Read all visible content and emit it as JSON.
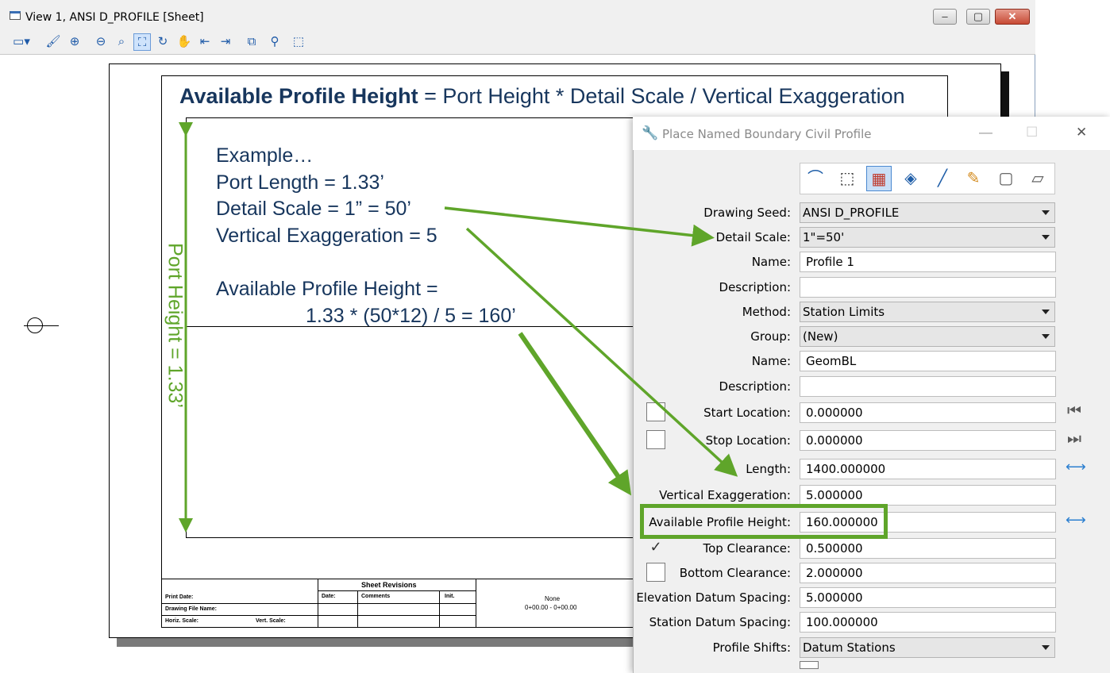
{
  "view": {
    "title": "View 1, ANSI D_PROFILE [Sheet]",
    "minimize": "–",
    "maximize": "▢",
    "close": "✕"
  },
  "sheet": {
    "formula_bold": "Available Profile Height",
    "formula_rest": " = Port Height * Detail Scale / Vertical Exaggeration",
    "example_title": "Example…",
    "port_length": "Port Length = 1.33’",
    "detail_scale": "Detail Scale = 1” = 50’",
    "vertical_exaggeration": "Vertical Exaggeration = 5",
    "aph_label": "Available Profile Height =",
    "aph_calc": "1.33 * (50*12) / 5 = 160’",
    "port_height": "Port Height = 1.33’",
    "titleblock": {
      "sheet_revisions": "Sheet Revisions",
      "print_date": "Print Date:",
      "drawing_file_name": "Drawing File Name:",
      "horiz_scale": "Horiz. Scale:",
      "vert_scale": "Vert. Scale:",
      "date": "Date:",
      "comments": "Comments",
      "init": "Init.",
      "none": "None",
      "station_range": "0+00.00 - 0+00.00"
    }
  },
  "dialog": {
    "title": "Place Named Boundary Civil Profile",
    "minimize": "—",
    "maximize": "☐",
    "close": "✕",
    "fields": {
      "drawing_seed": {
        "label": "Drawing Seed:",
        "value": "ANSI D_PROFILE"
      },
      "detail_scale": {
        "label": "Detail Scale:",
        "value": "1\"=50'"
      },
      "name1": {
        "label": "Name:",
        "value": "Profile 1"
      },
      "description1": {
        "label": "Description:",
        "value": ""
      },
      "method": {
        "label": "Method:",
        "value": "Station Limits"
      },
      "group": {
        "label": "Group:",
        "value": "(New)"
      },
      "name2": {
        "label": "Name:",
        "value": "GeomBL"
      },
      "description2": {
        "label": "Description:",
        "value": ""
      },
      "start_location": {
        "label": "Start Location:",
        "value": "0.000000"
      },
      "stop_location": {
        "label": "Stop Location:",
        "value": "0.000000"
      },
      "length": {
        "label": "Length:",
        "value": "1400.000000"
      },
      "vertical_exaggeration": {
        "label": "Vertical Exaggeration:",
        "value": "5.000000"
      },
      "available_profile_height": {
        "label": "Available Profile Height:",
        "value": "160.000000"
      },
      "top_clearance": {
        "label": "Top Clearance:",
        "value": "0.500000"
      },
      "bottom_clearance": {
        "label": "Bottom Clearance:",
        "value": "2.000000"
      },
      "elevation_datum_spacing": {
        "label": "Elevation Datum Spacing:",
        "value": "5.000000"
      },
      "station_datum_spacing": {
        "label": "Station Datum Spacing:",
        "value": "100.000000"
      },
      "profile_shifts": {
        "label": "Profile Shifts:",
        "value": "Datum Stations"
      }
    },
    "checks": {
      "top_clearance": "✓"
    },
    "colors": {
      "highlight": "#5fa52a",
      "text_blue": "#17365d"
    }
  }
}
